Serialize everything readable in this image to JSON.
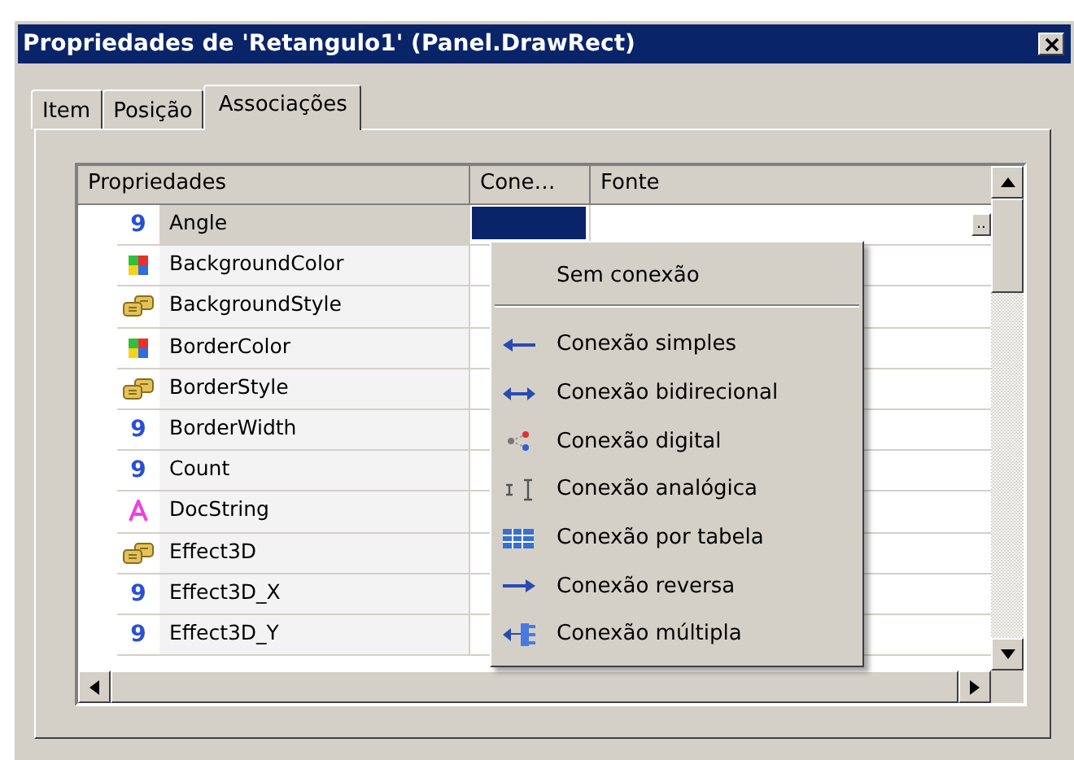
{
  "window": {
    "title": "Propriedades de 'Retangulo1' (Panel.DrawRect)"
  },
  "tabs": [
    {
      "label": "Item",
      "selected": false
    },
    {
      "label": "Posição",
      "selected": false
    },
    {
      "label": "Associações",
      "selected": true
    }
  ],
  "table": {
    "columns": [
      "Propriedades",
      "Cone…",
      "Fonte"
    ],
    "rows": [
      {
        "kind": "number",
        "icon": "9",
        "name": "Angle",
        "selected": true,
        "ellipsis": ".."
      },
      {
        "kind": "color",
        "name": "BackgroundColor",
        "selected": false
      },
      {
        "kind": "style",
        "name": "BackgroundStyle",
        "selected": false
      },
      {
        "kind": "color",
        "name": "BorderColor",
        "selected": false
      },
      {
        "kind": "style",
        "name": "BorderStyle",
        "selected": false
      },
      {
        "kind": "number",
        "icon": "9",
        "name": "BorderWidth",
        "selected": false
      },
      {
        "kind": "number",
        "icon": "9",
        "name": "Count",
        "selected": false
      },
      {
        "kind": "text",
        "name": "DocString",
        "selected": false
      },
      {
        "kind": "style",
        "name": "Effect3D",
        "selected": false
      },
      {
        "kind": "number",
        "icon": "9",
        "name": "Effect3D_X",
        "selected": false
      },
      {
        "kind": "number",
        "icon": "9",
        "name": "Effect3D_Y",
        "selected": false
      }
    ]
  },
  "menu": {
    "items": [
      {
        "kind": "none",
        "label": "Sem conexão"
      },
      {
        "kind": "simple",
        "label": "Conexão simples"
      },
      {
        "kind": "bidirectional",
        "label": "Conexão bidirecional"
      },
      {
        "kind": "digital",
        "label": "Conexão digital"
      },
      {
        "kind": "analog",
        "label": "Conexão analógica"
      },
      {
        "kind": "table",
        "label": "Conexão por tabela"
      },
      {
        "kind": "reverse",
        "label": "Conexão reversa"
      },
      {
        "kind": "multiple",
        "label": "Conexão múltipla"
      }
    ]
  }
}
